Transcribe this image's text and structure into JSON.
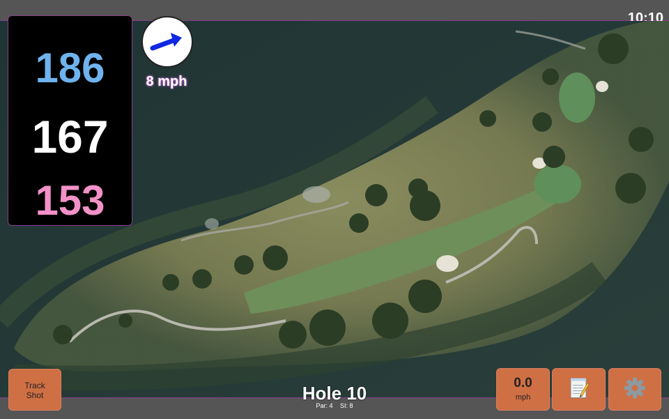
{
  "status": {
    "time": "10:10"
  },
  "yardages": {
    "back": "186",
    "center": "167",
    "front": "153",
    "back_color": "#6fb3ee",
    "center_color": "#ffffff",
    "front_color": "#f291c7"
  },
  "wind": {
    "speed": "8 mph",
    "arrow_color": "#1028e0",
    "icon": "wind-arrow-icon"
  },
  "buttons": {
    "track_shot_line1": "Track",
    "track_shot_line2": "Shot",
    "speed_value": "0.0",
    "speed_unit": "mph",
    "notes_icon": "notepad-icon",
    "settings_icon": "gear-icon",
    "accent": "#cf6f44"
  },
  "hole": {
    "title": "Hole 10",
    "par": "Par: 4",
    "stroke_index": "SI: 8"
  }
}
